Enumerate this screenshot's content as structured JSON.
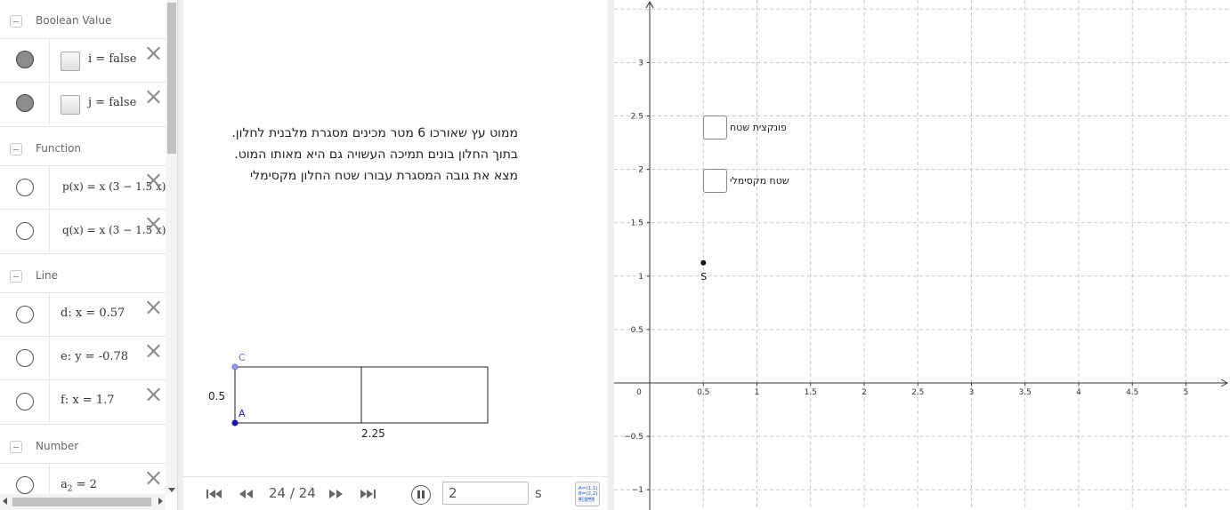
{
  "algebra": {
    "groups": {
      "boolean": "Boolean Value",
      "function": "Function",
      "line": "Line",
      "number": "Number"
    },
    "rows": {
      "i": "i = false",
      "j": "j = false",
      "p": "p(x) = x (3 − 1.5 x)",
      "q": "q(x) = x (3 − 1.5 x)",
      "d": "d: x = 0.57",
      "e": "e: y = -0.78",
      "f": "f: x = 1.7",
      "a2_base": "a",
      "a2_sub": "2",
      "a2_rest": " = 2"
    }
  },
  "graphics1": {
    "problem_lines": [
      "ממוט עץ שאורכו 6 מטר מכינים מסגרת מלבנית לחלון.",
      "בתוך החלון בונים תמיכה העשויה גם היא מאותו המוט.",
      "מצא את גובה המסגרת עבורו שטח החלון מקסימלי"
    ],
    "rect": {
      "width_value": 2.25,
      "height_value": 0.5
    },
    "labels": {
      "width": "2.25",
      "height": "0.5",
      "point_c": "C",
      "point_a": "A"
    },
    "player": {
      "counter": "24 / 24",
      "speed_value": "2",
      "unit": "s",
      "algebra_btn": [
        "A=(1,1)",
        "B=(2,2)",
        "a: y=x"
      ]
    }
  },
  "graphics2": {
    "checkbox_area_function": "פונקצית שטח",
    "checkbox_max_area": "שטח מקסימלי",
    "point_s_label": "S",
    "point_s": {
      "x": 0.5,
      "y": 1.125
    },
    "x_ticks": [
      "0",
      "0.5",
      "1",
      "1.5",
      "2",
      "2.5",
      "3",
      "3.5",
      "4",
      "4.5",
      "5"
    ],
    "y_ticks": [
      "3",
      "2.5",
      "2",
      "1.5",
      "1",
      "0.5",
      "−0.5",
      "−1"
    ]
  },
  "colors": {
    "point_blue": "#1a1aa6",
    "point_c": "#6a6ac8",
    "grid": "#c8c8c8"
  }
}
